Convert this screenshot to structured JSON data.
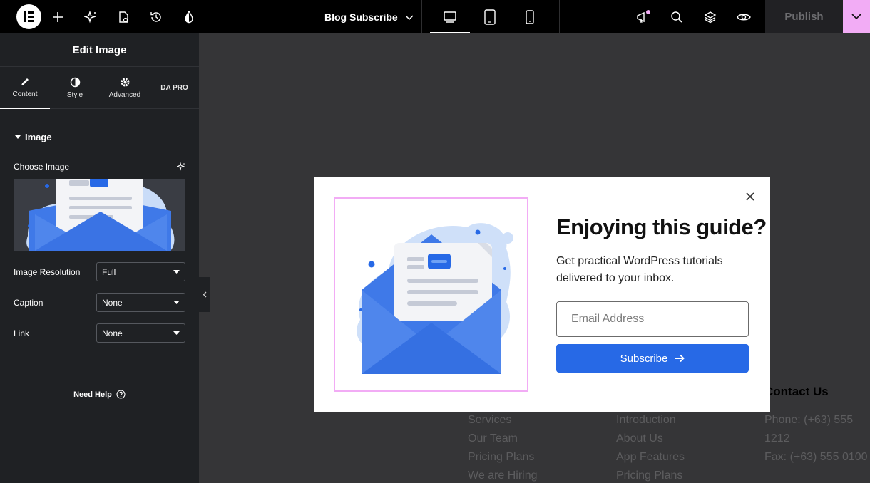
{
  "topbar": {
    "page_name": "Blog Subscribe",
    "publish_label": "Publish"
  },
  "panel": {
    "title": "Edit Image",
    "tabs": [
      {
        "label": "Content"
      },
      {
        "label": "Style"
      },
      {
        "label": "Advanced"
      },
      {
        "label": "DA PRO"
      }
    ],
    "section_title": "Image",
    "choose_image_label": "Choose Image",
    "controls": [
      {
        "label": "Image Resolution",
        "value": "Full"
      },
      {
        "label": "Caption",
        "value": "None"
      },
      {
        "label": "Link",
        "value": "None"
      }
    ],
    "help_label": "Need Help"
  },
  "footer": {
    "col1": [
      "Services",
      "Our Team",
      "Pricing Plans",
      "We are Hiring"
    ],
    "col2": [
      "Introduction",
      "About Us",
      "App Features",
      "Pricing Plans"
    ],
    "contact_heading": "Contact Us",
    "col3": [
      "Phone: (+63) 555",
      "1212",
      "Fax: (+63) 555 0100"
    ]
  },
  "popup": {
    "heading": "Enjoying this guide?",
    "description": "Get practical WordPress tutorials delivered to your inbox.",
    "email_placeholder": "Email Address",
    "subscribe_label": "Subscribe"
  },
  "colors": {
    "accent": "#2769e6",
    "highlight": "#f2acf5",
    "panel_bg": "#1f2124",
    "canvas_bg": "#353537"
  }
}
